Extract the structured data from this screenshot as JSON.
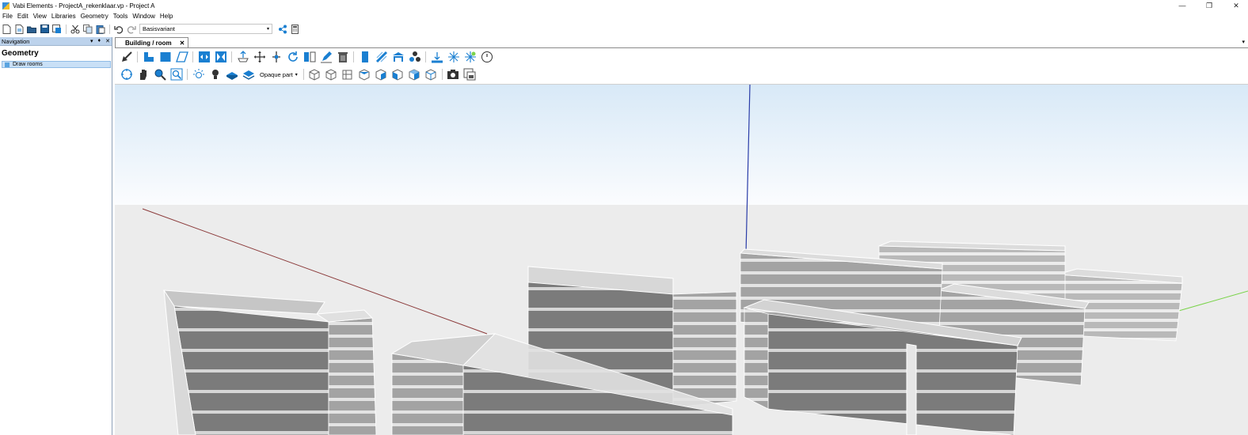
{
  "window": {
    "title": "Vabi Elements - ProjectA_rekenklaar.vp - Project A",
    "controls": [
      "minimize-icon",
      "restore-icon",
      "close-icon"
    ]
  },
  "menu": [
    "File",
    "Edit",
    "View",
    "Libraries",
    "Geometry",
    "Tools",
    "Window",
    "Help"
  ],
  "toolbar": {
    "variant_value": "Basisvariant",
    "icons": [
      "new-file-icon",
      "new-from-template-icon",
      "open-icon",
      "save-icon",
      "save-as-icon",
      "cut-icon",
      "copy-icon",
      "paste-icon",
      "undo-icon",
      "redo-icon",
      "share-icon",
      "calculator-icon"
    ]
  },
  "navigation": {
    "header": "Navigation",
    "section": "Geometry",
    "items": [
      {
        "label": "Draw rooms",
        "selected": true
      }
    ]
  },
  "document": {
    "tab_label": "Building / room"
  },
  "ribbon": {
    "opaque_label": "Opaque part",
    "row1_icons": [
      "select-arrow-icon",
      "draw-polygon-room-icon",
      "draw-rectangle-room-icon",
      "draw-parallelogram-icon",
      "split-horizontal-icon",
      "split-vertical-icon",
      "raise-icon",
      "move-icon",
      "move-vertical-icon",
      "rotate-icon",
      "mirror-icon",
      "edit-icon",
      "delete-icon",
      "wall-icon",
      "window-icon",
      "roof-icon",
      "group-icon",
      "measure-icon",
      "snap-icon",
      "snap-grid-icon",
      "clock-icon"
    ],
    "row2_icons": [
      "orbit-icon",
      "pan-hand-icon",
      "zoom-icon",
      "zoom-extents-icon",
      "light-icon",
      "bulb-icon",
      "layer-icon",
      "layers-icon",
      "view-cube-front-icon",
      "view-cube-back-icon",
      "view-cube-left-icon",
      "view-cube-right-icon",
      "view-cube-top-icon",
      "view-cube-bottom-icon",
      "view-cube-iso-icon",
      "view-cube-wire-icon",
      "camera-icon",
      "snapshot-icon"
    ]
  },
  "colors": {
    "accent": "#1a7fd1",
    "panel_header": "#bdd3ec",
    "selection": "#c9e0f6",
    "sky_top": "#d8e9f7",
    "ground": "#ececec",
    "axis_x": "#8b3a3a",
    "axis_y": "#7ad34a",
    "axis_z": "#2a3ca8"
  }
}
